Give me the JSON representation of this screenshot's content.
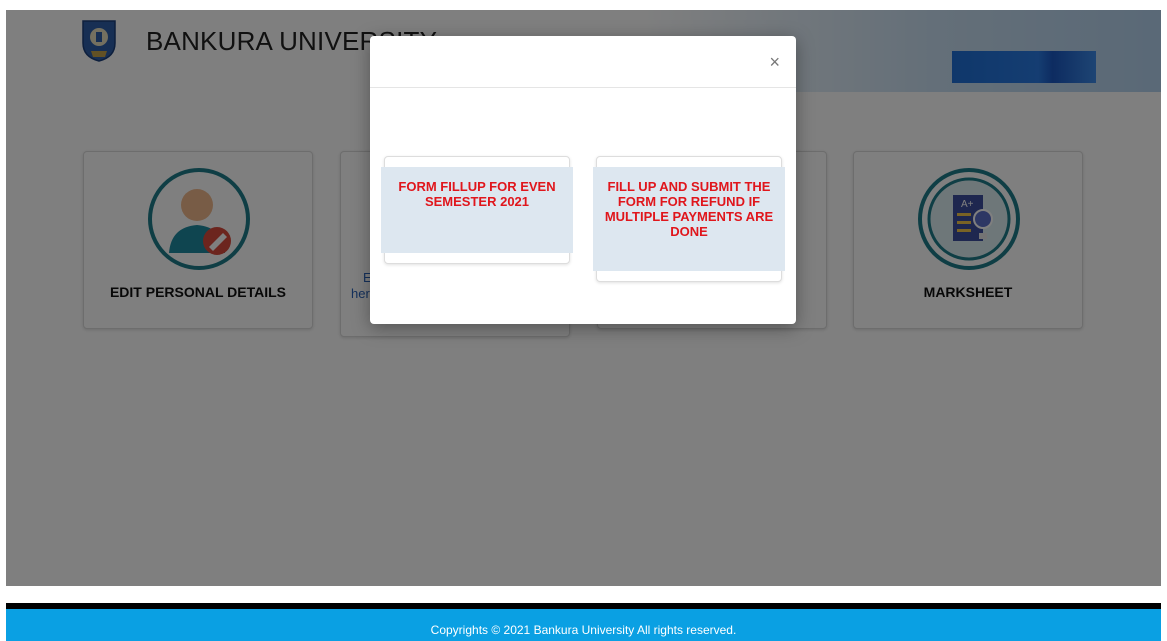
{
  "header": {
    "title": "BANKURA UNIVERSITY"
  },
  "cards": [
    {
      "label": "EDIT PERSONAL DETAILS",
      "icon": "user-edit-icon"
    },
    {
      "label": "",
      "text_line1": "E",
      "text_line2": "her",
      "icon": ""
    },
    {
      "label": "",
      "icon": ""
    },
    {
      "label": "MARKSHEET",
      "icon": "marksheet-icon"
    }
  ],
  "modal": {
    "close_label": "×",
    "options": [
      {
        "label": "FORM FILLUP FOR EVEN SEMESTER 2021"
      },
      {
        "label": "FILL UP AND SUBMIT THE FORM FOR REFUND IF MULTIPLE PAYMENTS ARE DONE"
      }
    ]
  },
  "footer": {
    "copyright": "Copyrights © 2021 Bankura University All rights reserved."
  },
  "colors": {
    "overlay": "rgba(0,0,0,0.5)",
    "footer": "#0aa0e3",
    "option_text": "#e0161c",
    "option_bg": "#dde7f0",
    "icon_teal": "#1e7d8a"
  }
}
